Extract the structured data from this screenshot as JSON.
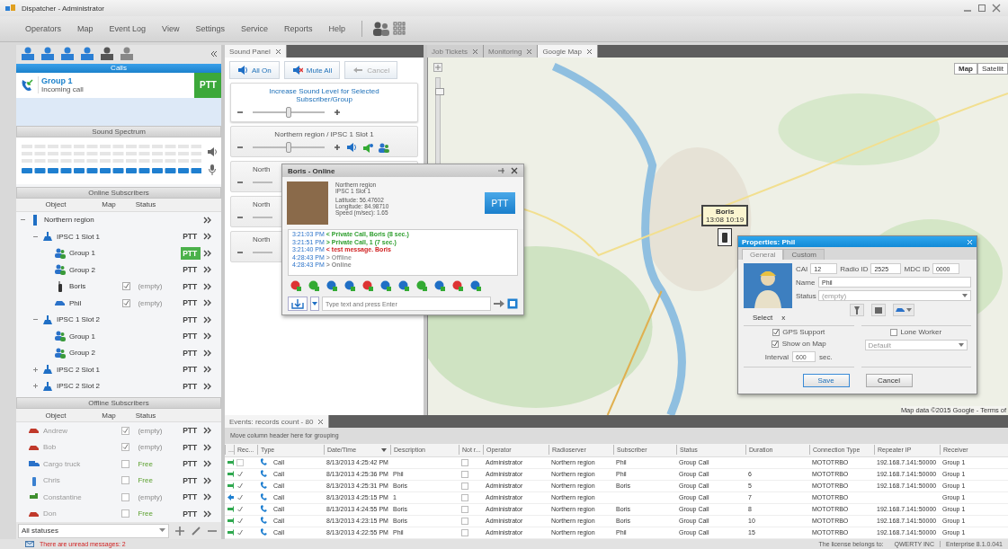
{
  "window": {
    "title": "Dispatcher - Administrator"
  },
  "menu": [
    "Operators",
    "Map",
    "Event Log",
    "View",
    "Settings",
    "Service",
    "Reports",
    "Help"
  ],
  "left_panel": {
    "calls": {
      "title": "Calls",
      "items": [
        {
          "name": "Group 1",
          "status": "Incoming call",
          "ptt": "PTT",
          "ptt_active": true
        }
      ]
    },
    "sound_spectrum": {
      "title": "Sound Spectrum"
    },
    "online_subscribers": {
      "title": "Online Subscribers",
      "columns": [
        "Object",
        "Map",
        "Status"
      ],
      "tree": [
        {
          "name": "Northern region",
          "kind": "region",
          "expanded": true,
          "children": [
            {
              "name": "IPSC 1 Slot 1",
              "kind": "slot",
              "expanded": true,
              "ptt": "PTT",
              "ptt_active": false,
              "children": [
                {
                  "name": "Group 1",
                  "kind": "group",
                  "ptt": "PTT",
                  "ptt_active": true
                },
                {
                  "name": "Group 2",
                  "kind": "group",
                  "ptt": "PTT",
                  "ptt_active": false
                },
                {
                  "name": "Boris",
                  "kind": "radio",
                  "map_checked": true,
                  "status": "(empty)",
                  "available": false,
                  "ptt": "PTT",
                  "ptt_active": false
                },
                {
                  "name": "Phil",
                  "kind": "car",
                  "map_checked": true,
                  "status": "(empty)",
                  "available": false,
                  "ptt": "PTT",
                  "ptt_active": false
                }
              ]
            },
            {
              "name": "IPSC 1 Slot 2",
              "kind": "slot",
              "expanded": true,
              "ptt": "PTT",
              "ptt_active": false,
              "children": [
                {
                  "name": "Group 1",
                  "kind": "group",
                  "ptt": "PTT",
                  "ptt_active": false
                },
                {
                  "name": "Group 2",
                  "kind": "group",
                  "ptt": "PTT",
                  "ptt_active": false
                }
              ]
            },
            {
              "name": "IPSC 2 Slot 1",
              "kind": "slot",
              "expanded": false,
              "ptt": "PTT",
              "ptt_active": false
            },
            {
              "name": "IPSC 2 Slot 2",
              "kind": "slot",
              "expanded": false,
              "ptt": "PTT",
              "ptt_active": false
            }
          ]
        }
      ]
    },
    "offline_subscribers": {
      "title": "Offline Subscribers",
      "columns": [
        "Object",
        "Map",
        "Status"
      ],
      "items": [
        {
          "name": "Andrew",
          "kind": "car",
          "map_checked": true,
          "status": "(empty)",
          "available": false,
          "ptt": "PTT"
        },
        {
          "name": "Bob",
          "kind": "car",
          "map_checked": true,
          "status": "(empty)",
          "available": false,
          "ptt": "PTT"
        },
        {
          "name": "Cargo truck",
          "kind": "truck",
          "map_checked": false,
          "status": "Free",
          "available": true,
          "ptt": "PTT"
        },
        {
          "name": "Chris",
          "kind": "radio",
          "map_checked": false,
          "status": "Free",
          "available": true,
          "ptt": "PTT"
        },
        {
          "name": "Constantine",
          "kind": "tractor",
          "map_checked": false,
          "status": "(empty)",
          "available": false,
          "ptt": "PTT"
        },
        {
          "name": "Don",
          "kind": "car",
          "map_checked": false,
          "status": "Free",
          "available": true,
          "ptt": "PTT"
        }
      ]
    },
    "status_filter": {
      "value": "All statuses"
    }
  },
  "sound_panel": {
    "tab": "Sound Panel",
    "buttons": [
      {
        "label": "All On",
        "kind": "speaker",
        "disabled": false
      },
      {
        "label": "Mute All",
        "kind": "mute",
        "disabled": false
      },
      {
        "label": "Cancel",
        "kind": "undo",
        "disabled": true
      }
    ],
    "cards": [
      {
        "kind": "master",
        "title": "Increase Sound Level for Selected Subscriber/Group",
        "level": 0.5
      },
      {
        "kind": "channel",
        "title": "Northern region / IPSC 1 Slot 1",
        "level": 0.5
      },
      {
        "kind": "partial",
        "title": "North"
      },
      {
        "kind": "partial",
        "title": "North"
      },
      {
        "kind": "partial",
        "title": "North"
      }
    ]
  },
  "map_tabs": [
    {
      "label": "Job Tickets",
      "selected": false
    },
    {
      "label": "Monitoring",
      "selected": false
    },
    {
      "label": "Google Map",
      "selected": true
    }
  ],
  "map": {
    "zoom": {
      "level": 0.85
    },
    "map_types": [
      {
        "label": "Map",
        "selected": true
      },
      {
        "label": "Satellit",
        "selected": false
      }
    ],
    "marker": {
      "name": "Boris",
      "time": "13:08 10:19"
    },
    "attribution": "Map data ©2015 Google - Terms of"
  },
  "subscriber_popup": {
    "title": "Boris - Online",
    "info": [
      "Northern region",
      "IPSC 1 Slot 1",
      "Latitude: 56.47602",
      "Longitude: 84.98710",
      "Speed (m/sec): 1.65"
    ],
    "ptt": "PTT",
    "log": [
      {
        "time": "3:21:03 PM",
        "text": "< Private Call, Boris (8 sec.)",
        "color": "#2e9e2e"
      },
      {
        "time": "3:21:51 PM",
        "text": "> Private Call, 1 (7 sec.)",
        "color": "#2e9e2e"
      },
      {
        "time": "3:21:40 PM",
        "text": "< test message. Boris",
        "color": "#d02020"
      },
      {
        "time": "4:28:43 PM",
        "text": "> Offline",
        "color": "#9a9a9a"
      },
      {
        "time": "4:28:43 PM",
        "text": "> Online",
        "color": "#8a8a8a"
      }
    ],
    "message_placeholder": "Type text and press Enter"
  },
  "properties_dialog": {
    "title": "Properties: Phil",
    "tabs": [
      {
        "label": "General",
        "selected": true
      },
      {
        "label": "Custom",
        "selected": false
      }
    ],
    "cai": {
      "label": "CAI",
      "value": "12"
    },
    "radio_id": {
      "label": "Radio ID",
      "value": "2525"
    },
    "mdc_id": {
      "label": "MDC ID",
      "value": "0000"
    },
    "name": {
      "label": "Name",
      "value": "Phil"
    },
    "status": {
      "label": "Status",
      "value": "(empty)"
    },
    "select": {
      "label": "Select",
      "clear": "x"
    },
    "gps_support": {
      "label": "GPS Support",
      "checked": true
    },
    "lone_worker": {
      "label": "Lone Worker",
      "checked": false
    },
    "show_on_map": {
      "label": "Show on Map",
      "checked": true
    },
    "interval": {
      "label": "Interval",
      "value": "600",
      "unit": "sec."
    },
    "lone_worker_mode": {
      "value": "Default"
    },
    "buttons": [
      "Save",
      "Cancel"
    ]
  },
  "events": {
    "tab": "Events: records count - 80",
    "grouping_hint": "Move column header here for grouping",
    "columns": [
      "...",
      "Rec...",
      "Type",
      "Date/Time",
      "Description",
      "Not r...",
      "Operator",
      "Radioserver",
      "Subscriber",
      "Status",
      "Duration",
      "Connection Type",
      "Repeater IP",
      "Receiver"
    ],
    "rows": [
      {
        "incoming": true,
        "recorded": false,
        "type": "Call",
        "datetime": "8/13/2013 4:25:42 PM",
        "description": "",
        "not_read": false,
        "operator": "Administrator",
        "radioserver": "Northern region",
        "subscriber": "Phil",
        "status": "Group Call",
        "duration": "",
        "connection": "MOTOTRBO",
        "repeater_ip": "192.168.7.141:50000",
        "receiver": "Group 1"
      },
      {
        "incoming": true,
        "recorded": true,
        "type": "Call",
        "datetime": "8/13/2013 4:25:36 PM",
        "description": "Phil",
        "not_read": false,
        "operator": "Administrator",
        "radioserver": "Northern region",
        "subscriber": "Phil",
        "status": "Group Call",
        "duration": "6",
        "connection": "MOTOTRBO",
        "repeater_ip": "192.168.7.141:50000",
        "receiver": "Group 1"
      },
      {
        "incoming": true,
        "recorded": true,
        "type": "Call",
        "datetime": "8/13/2013 4:25:31 PM",
        "description": "Boris",
        "not_read": false,
        "operator": "Administrator",
        "radioserver": "Northern region",
        "subscriber": "Boris",
        "status": "Group Call",
        "duration": "5",
        "connection": "MOTOTRBO",
        "repeater_ip": "192.168.7.141:50000",
        "receiver": "Group 1"
      },
      {
        "incoming": false,
        "recorded": true,
        "type": "Call",
        "datetime": "8/13/2013 4:25:15 PM",
        "description": "1",
        "not_read": false,
        "operator": "Administrator",
        "radioserver": "Northern region",
        "subscriber": "",
        "status": "Group Call",
        "duration": "7",
        "connection": "MOTOTRBO",
        "repeater_ip": "",
        "receiver": "Group 1"
      },
      {
        "incoming": true,
        "recorded": true,
        "type": "Call",
        "datetime": "8/13/2013 4:24:55 PM",
        "description": "Boris",
        "not_read": false,
        "operator": "Administrator",
        "radioserver": "Northern region",
        "subscriber": "Boris",
        "status": "Group Call",
        "duration": "8",
        "connection": "MOTOTRBO",
        "repeater_ip": "192.168.7.141:50000",
        "receiver": "Group 1"
      },
      {
        "incoming": true,
        "recorded": true,
        "type": "Call",
        "datetime": "8/13/2013 4:23:15 PM",
        "description": "Boris",
        "not_read": false,
        "operator": "Administrator",
        "radioserver": "Northern region",
        "subscriber": "Boris",
        "status": "Group Call",
        "duration": "10",
        "connection": "MOTOTRBO",
        "repeater_ip": "192.168.7.141:50000",
        "receiver": "Group 1"
      },
      {
        "incoming": true,
        "recorded": true,
        "type": "Call",
        "datetime": "8/13/2013 4:22:55 PM",
        "description": "Phil",
        "not_read": false,
        "operator": "Administrator",
        "radioserver": "Northern region",
        "subscriber": "Phil",
        "status": "Group Call",
        "duration": "15",
        "connection": "MOTOTRBO",
        "repeater_ip": "192.168.7.141:50000",
        "receiver": "Group 1"
      }
    ]
  },
  "status_bar": {
    "unread": "There are unread messages: 2",
    "license_label": "The license belongs to:",
    "license_owner": "QWERTY INC",
    "version": "Enterprise 8.1.0.041"
  }
}
